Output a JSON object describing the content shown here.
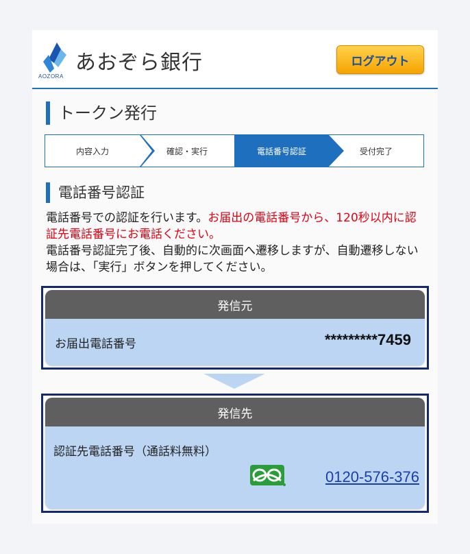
{
  "header": {
    "bank_name": "あおぞら銀行",
    "logo_sub": "AOZORA",
    "logout_label": "ログアウト"
  },
  "page": {
    "title": "トークン発行"
  },
  "steps": [
    {
      "label": "内容入力",
      "active": false
    },
    {
      "label": "確認・実行",
      "active": false
    },
    {
      "label": "電話番号認証",
      "active": true
    },
    {
      "label": "受付完了",
      "active": false
    }
  ],
  "section": {
    "title": "電話番号認証",
    "desc_1": "電話番号での認証を行います。",
    "desc_red": "お届出の電話番号から、120秒以内に認証先電話番号にお電話ください。",
    "desc_2": "電話番号認証完了後、自動的に次画面へ遷移しますが、自動遷移しない場合は、「実行」ボタンを押してください。"
  },
  "from_panel": {
    "heading": "発信元",
    "label": "お届出電話番号",
    "value": "*********7459"
  },
  "to_panel": {
    "heading": "発信先",
    "label": "認証先電話番号（通話料無料）",
    "phone": "0120-576-376",
    "freedial_icon": "freedial-icon"
  },
  "colors": {
    "brand_blue": "#1f6fbf",
    "panel_border": "#14286e",
    "panel_bg": "#bcd5f3",
    "alert_red": "#e60012",
    "logout_orange": "#f6a400",
    "freedial_green": "#2a9d3a"
  }
}
